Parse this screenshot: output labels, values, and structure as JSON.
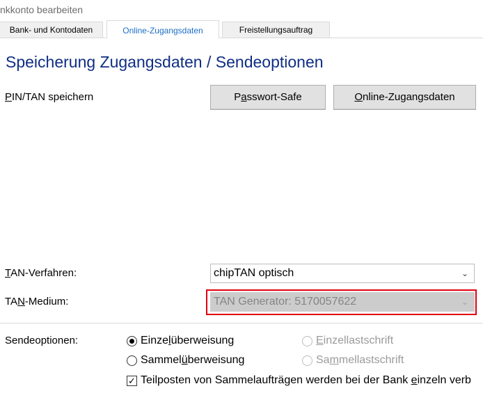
{
  "window": {
    "title": "nkkonto bearbeiten"
  },
  "tabs": [
    {
      "label": "Bank- und Kontodaten",
      "active": false
    },
    {
      "label": "Online-Zugangsdaten",
      "active": true
    },
    {
      "label": "Freistellungsauftrag",
      "active": false
    }
  ],
  "page": {
    "heading": "Speicherung Zugangsdaten / Sendeoptionen"
  },
  "pin_tan": {
    "label_pre": "",
    "label_ul": "P",
    "label_post": "IN/TAN speichern",
    "btn_safe_pre": "P",
    "btn_safe_ul": "a",
    "btn_safe_post": "sswort-Safe",
    "btn_online_pre": "",
    "btn_online_ul": "O",
    "btn_online_post": "nline-Zugangsdaten"
  },
  "tan_verfahren": {
    "label_pre": "",
    "label_ul": "T",
    "label_post": "AN-Verfahren:",
    "value": "chipTAN optisch"
  },
  "tan_medium": {
    "label_pre": "TA",
    "label_ul": "N",
    "label_post": "-Medium:",
    "value": "TAN Generator: 5170057622",
    "disabled": true
  },
  "sendeoptionen": {
    "label": "Sendeoptionen:",
    "einzel_pre": "Einze",
    "einzel_ul": "l",
    "einzel_post": "überweisung",
    "sammel_pre": "Sammel",
    "sammel_ul": "ü",
    "sammel_post": "berweisung",
    "einzellast_pre": "",
    "einzellast_ul": "E",
    "einzellast_post": "inzellastschrift",
    "sammellast_pre": "Sa",
    "sammellast_ul": "m",
    "sammellast_post": "mellastschrift",
    "teilposten_pre": "Teilposten von Sammelaufträgen werden bei der Bank ",
    "teilposten_ul": "e",
    "teilposten_post": "inzeln verb"
  },
  "colors": {
    "heading": "#0f2e85",
    "active_tab": "#1c6ec4",
    "highlight": "#e1000f"
  }
}
